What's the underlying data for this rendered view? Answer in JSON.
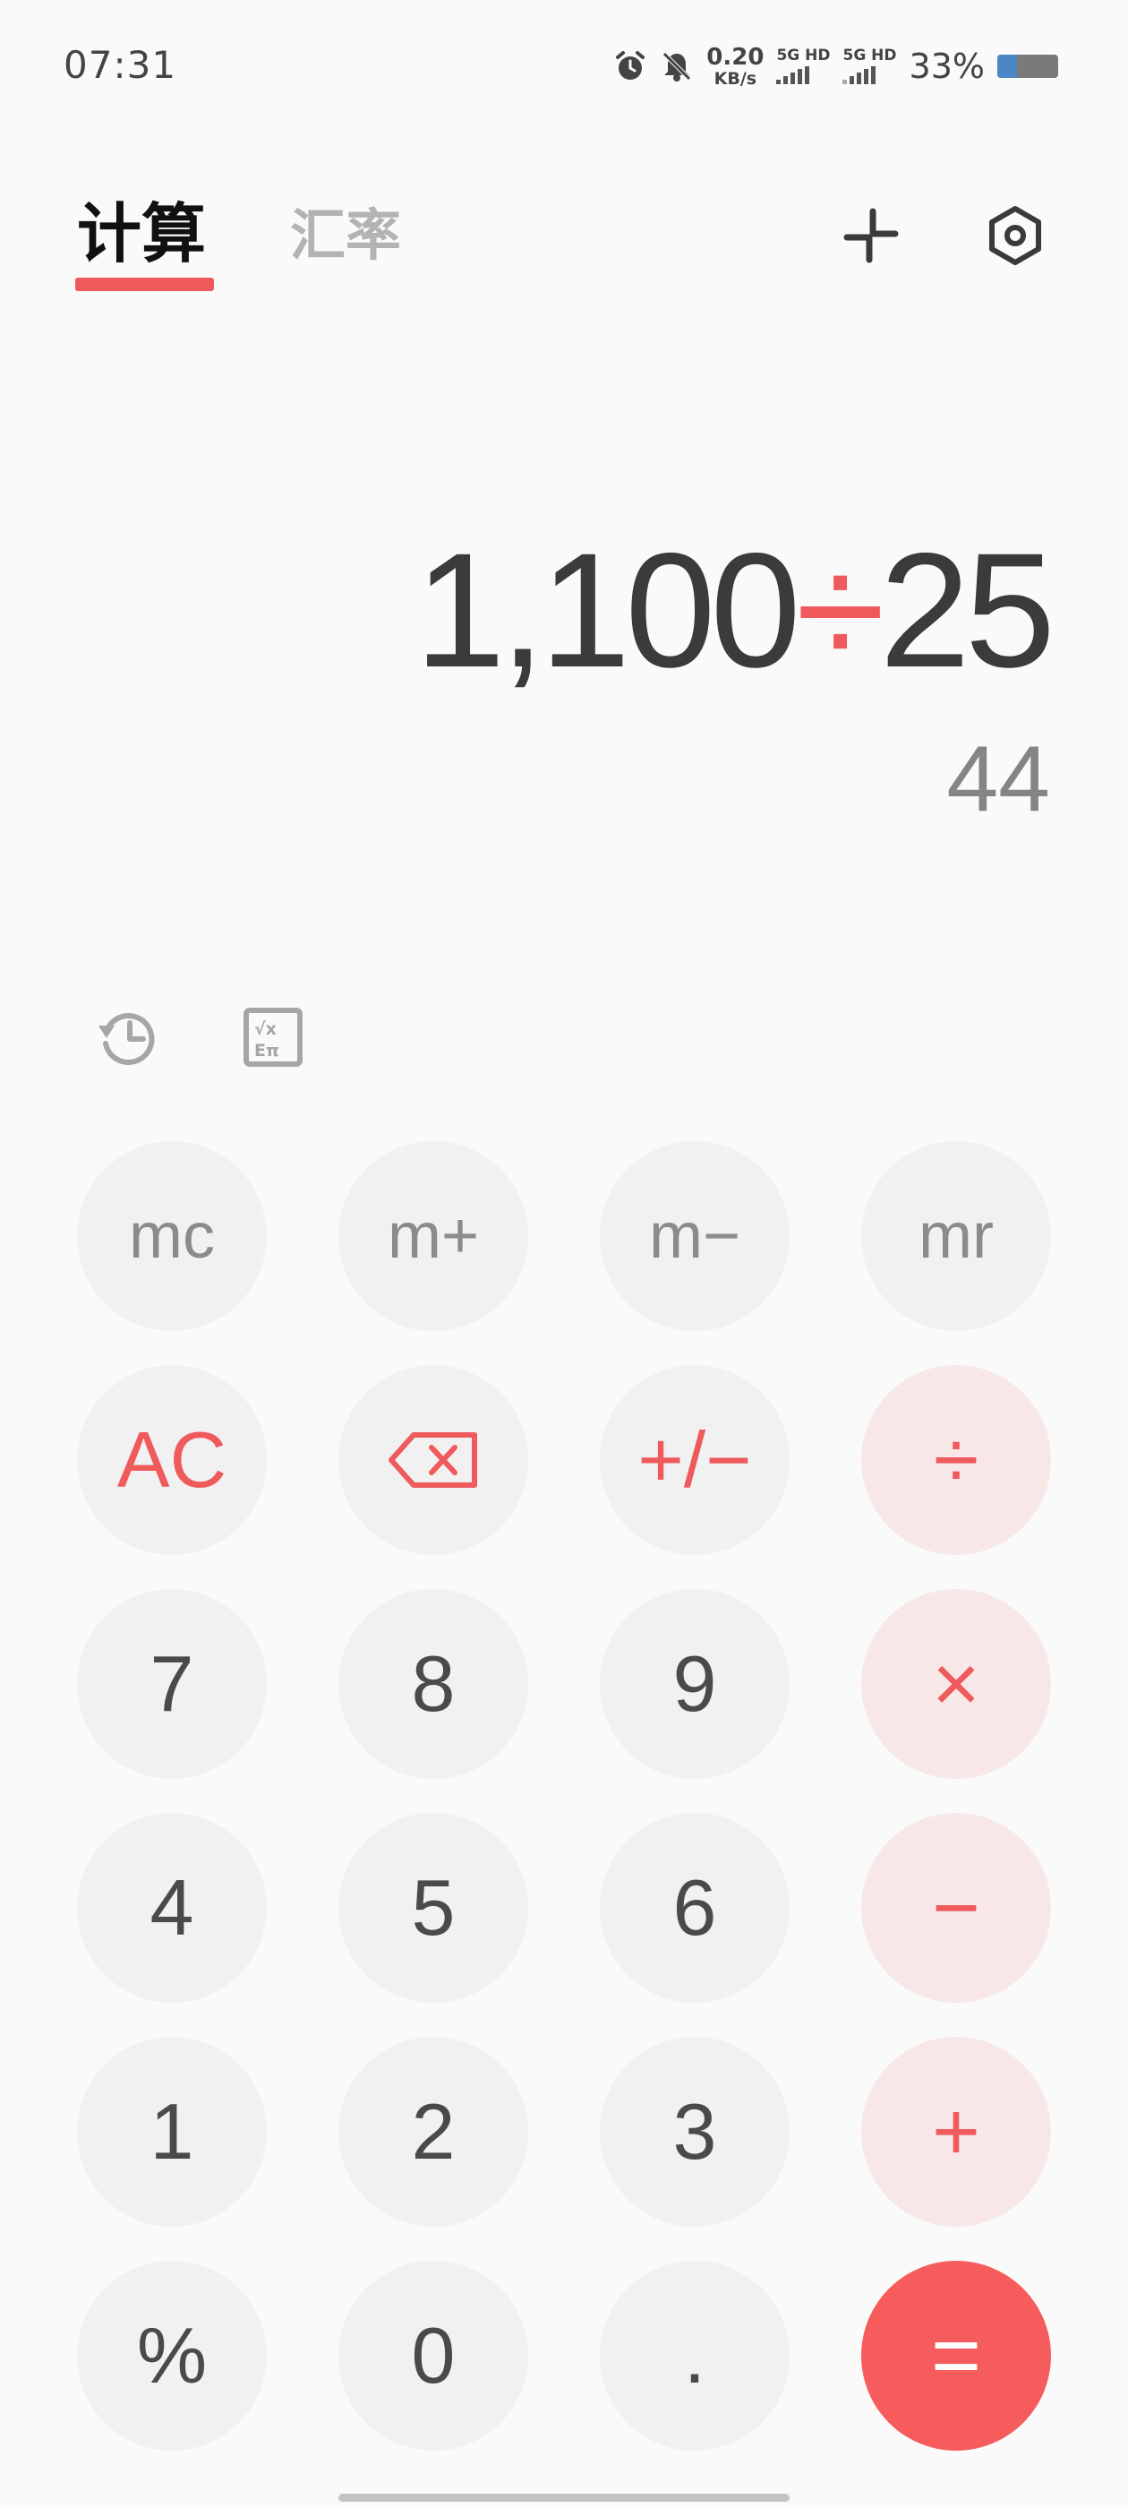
{
  "status_bar": {
    "time": "07:31",
    "speed_value": "0.20",
    "speed_unit": "KB/s",
    "sim1_label": "5G HD",
    "sim2_label": "5G HD",
    "battery_percent": "33%",
    "battery_level": 0.33,
    "icons": [
      "alarm-icon",
      "mute-icon",
      "signal-icon",
      "battery-icon"
    ]
  },
  "header": {
    "tabs": [
      {
        "label": "计算",
        "active": true
      },
      {
        "label": "汇率",
        "active": false
      }
    ],
    "icons": [
      "collapse-icon",
      "settings-icon"
    ],
    "accent_color": "#f0595b"
  },
  "display": {
    "operand1": "1,100",
    "operator": "÷",
    "operand2": "25",
    "result": "44"
  },
  "tools": {
    "icons": [
      "history-icon",
      "scientific-icon"
    ]
  },
  "keypad": {
    "rows": [
      [
        {
          "label": "mc",
          "kind": "mem",
          "name": "memory-clear-button"
        },
        {
          "label": "m+",
          "kind": "mem",
          "name": "memory-add-button"
        },
        {
          "label": "m−",
          "kind": "mem",
          "name": "memory-subtract-button"
        },
        {
          "label": "mr",
          "kind": "mem",
          "name": "memory-recall-button"
        }
      ],
      [
        {
          "label": "AC",
          "kind": "red-text",
          "name": "all-clear-button"
        },
        {
          "label": "",
          "kind": "backspace",
          "name": "backspace-button"
        },
        {
          "label": "+/−",
          "kind": "red-text",
          "name": "sign-toggle-button"
        },
        {
          "label": "÷",
          "kind": "op",
          "name": "divide-button"
        }
      ],
      [
        {
          "label": "7",
          "kind": "num",
          "name": "digit-7-button"
        },
        {
          "label": "8",
          "kind": "num",
          "name": "digit-8-button"
        },
        {
          "label": "9",
          "kind": "num",
          "name": "digit-9-button"
        },
        {
          "label": "×",
          "kind": "op",
          "name": "multiply-button"
        }
      ],
      [
        {
          "label": "4",
          "kind": "num",
          "name": "digit-4-button"
        },
        {
          "label": "5",
          "kind": "num",
          "name": "digit-5-button"
        },
        {
          "label": "6",
          "kind": "num",
          "name": "digit-6-button"
        },
        {
          "label": "−",
          "kind": "op",
          "name": "subtract-button"
        }
      ],
      [
        {
          "label": "1",
          "kind": "num",
          "name": "digit-1-button"
        },
        {
          "label": "2",
          "kind": "num",
          "name": "digit-2-button"
        },
        {
          "label": "3",
          "kind": "num",
          "name": "digit-3-button"
        },
        {
          "label": "+",
          "kind": "op",
          "name": "add-button"
        }
      ],
      [
        {
          "label": "%",
          "kind": "num",
          "name": "percent-button"
        },
        {
          "label": "0",
          "kind": "num",
          "name": "digit-0-button"
        },
        {
          "label": ".",
          "kind": "num",
          "name": "decimal-point-button"
        },
        {
          "label": "=",
          "kind": "eq",
          "name": "equals-button"
        }
      ]
    ]
  }
}
